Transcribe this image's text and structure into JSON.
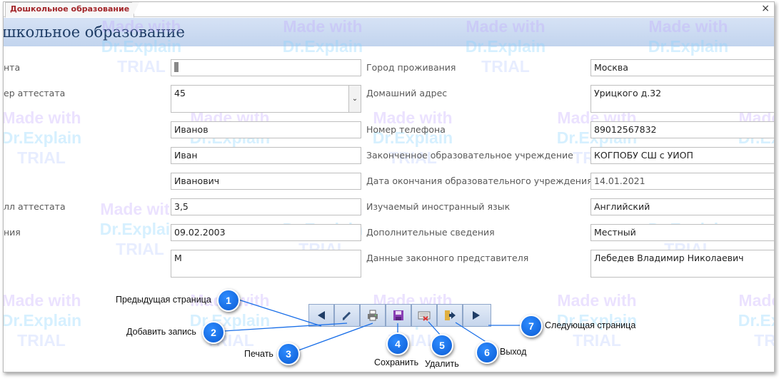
{
  "tab": {
    "title": "Дошкольное образование",
    "close": "×"
  },
  "banner": {
    "title": "школьное образование"
  },
  "left_labels": [
    "нта",
    "ер аттестата",
    "лл аттестата",
    "ния"
  ],
  "right_labels": [
    "Город проживания",
    "Домашний адрес",
    "Номер телефона",
    "Законченное образовательное учреждение",
    "Дата окончания образовательного учреждения",
    "Изучаемый иностранный язык",
    "Дополнительные сведения",
    "Данные законного представителя"
  ],
  "left_fields": [
    "",
    "45",
    "Иванов",
    "Иван",
    "Иванович",
    "3,5",
    "09.02.2003",
    "М"
  ],
  "right_fields": [
    "Москва",
    "Урицкого д.32",
    "89012567832",
    "КОГПОБУ СШ с УИОП",
    "14.01.2021",
    "Английский",
    "Местный",
    "Лебедев Владимир Николаевич"
  ],
  "watermark": {
    "line1": "Made with",
    "line2": "Dr.Explain",
    "line3": "TRIAL"
  },
  "nav_buttons": [
    "arrow-left-icon",
    "pencil-icon",
    "printer-icon",
    "save-icon",
    "delete-icon",
    "exit-icon",
    "arrow-right-icon"
  ],
  "callouts": [
    {
      "num": "1",
      "label": "Предыдущая страница"
    },
    {
      "num": "2",
      "label": "Добавить запись"
    },
    {
      "num": "3",
      "label": "Печать"
    },
    {
      "num": "4",
      "label": "Сохранить"
    },
    {
      "num": "5",
      "label": "Удалить"
    },
    {
      "num": "6",
      "label": "Выход"
    },
    {
      "num": "7",
      "label": "Следующая страница"
    }
  ],
  "colors": {
    "accent": "#a3262a",
    "banner": "#c8d8f0",
    "callout": "#1a6fe8",
    "button": "#c9d8ee"
  }
}
